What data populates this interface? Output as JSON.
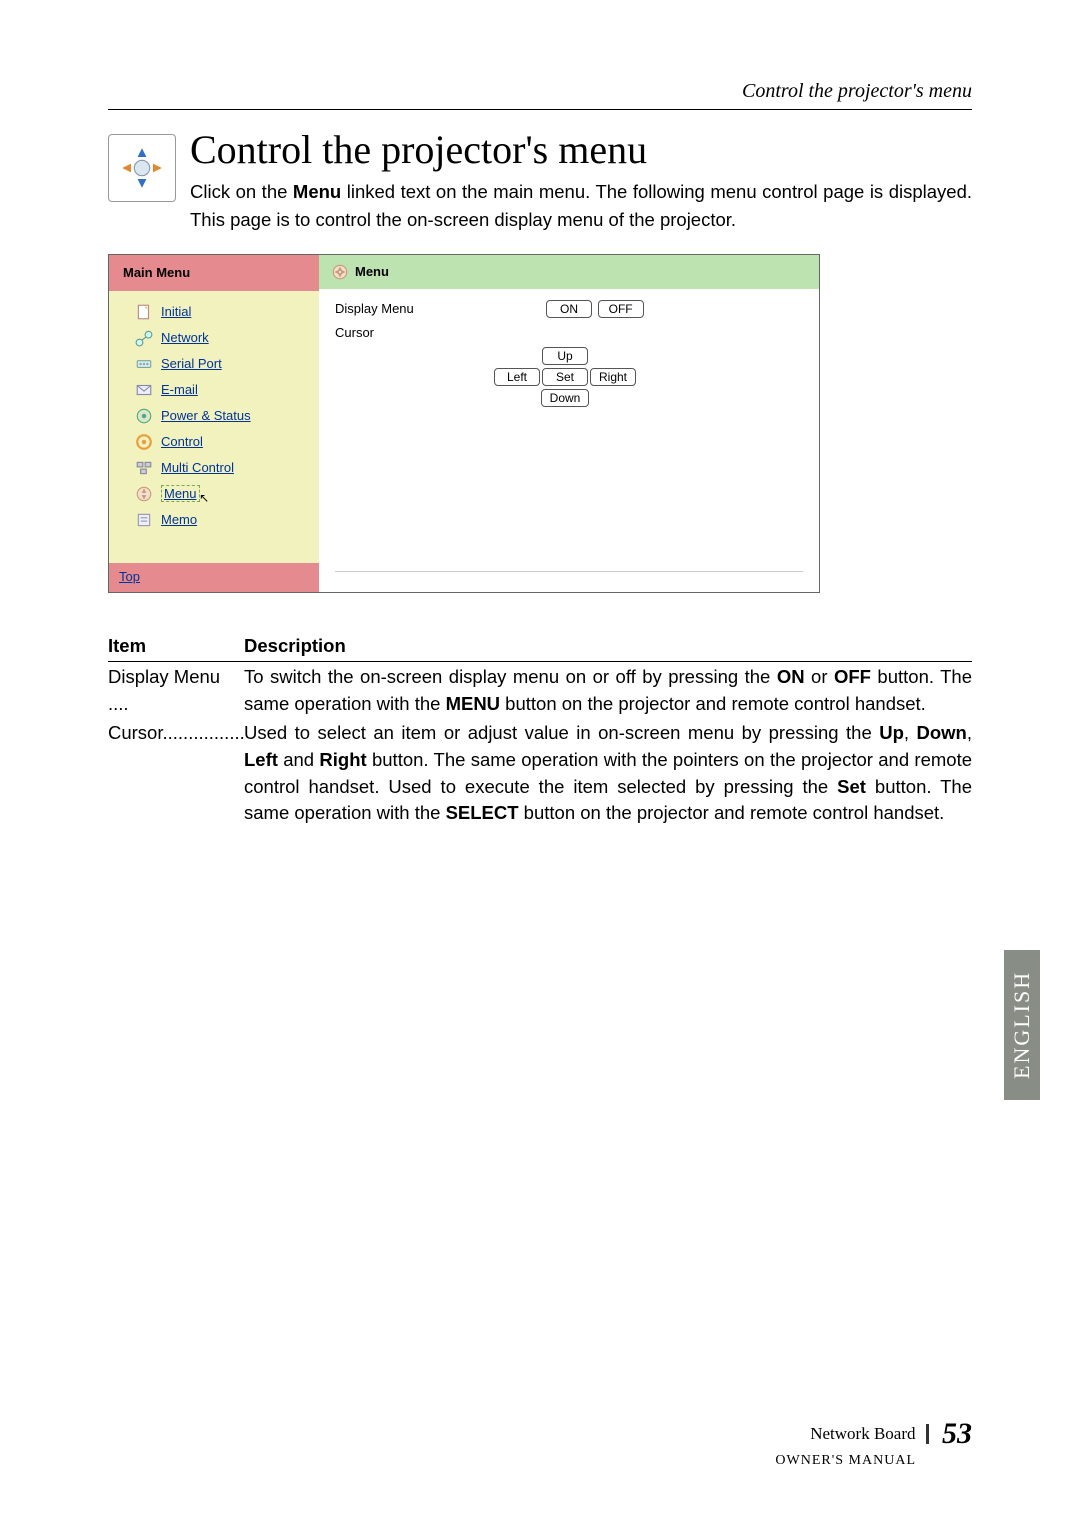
{
  "header": {
    "running": "Control the projector's menu"
  },
  "title": "Control the projector's menu",
  "intro": {
    "pre": "Click on the ",
    "bold1": "Menu",
    "post": " linked text on the main menu. The following menu control page is displayed. This page is to control the on-screen display menu of the projector."
  },
  "screenshot": {
    "mainMenuLabel": "Main Menu",
    "menuLabel": "Menu",
    "items": [
      "Initial",
      "Network",
      "Serial Port",
      "E-mail",
      "Power & Status",
      "Control",
      "Multi Control",
      "Menu",
      "Memo"
    ],
    "topLink": "Top",
    "fields": {
      "displayMenu": "Display Menu",
      "cursor": "Cursor"
    },
    "buttons": {
      "on": "ON",
      "off": "OFF",
      "up": "Up",
      "left": "Left",
      "set": "Set",
      "right": "Right",
      "down": "Down"
    }
  },
  "table": {
    "head": {
      "item": "Item",
      "desc": "Description"
    },
    "rows": [
      {
        "item": "Display Menu",
        "dots": " ....",
        "parts": [
          "To switch the on-screen display menu on or off by pressing the ",
          "ON",
          " or ",
          "OFF",
          " button. The same operation with the ",
          "MENU",
          " button on the projector and remote control handset."
        ]
      },
      {
        "item": "Cursor",
        "dots": "................",
        "parts": [
          "Used to select an item or adjust value in on-screen menu by pressing the ",
          "Up",
          ", ",
          "Down",
          ", ",
          "Left",
          " and ",
          "Right",
          " button. The same operation with the pointers on the projector and remote control handset. Used to execute the item selected by pressing the ",
          "Set",
          " button. The same operation with the ",
          "SELECT",
          " button on the projector and remote control handset."
        ]
      }
    ]
  },
  "sideLabel": "ENGLISH",
  "footer": {
    "line1": "Network Board",
    "page": "53",
    "line2": "OWNER'S MANUAL"
  }
}
